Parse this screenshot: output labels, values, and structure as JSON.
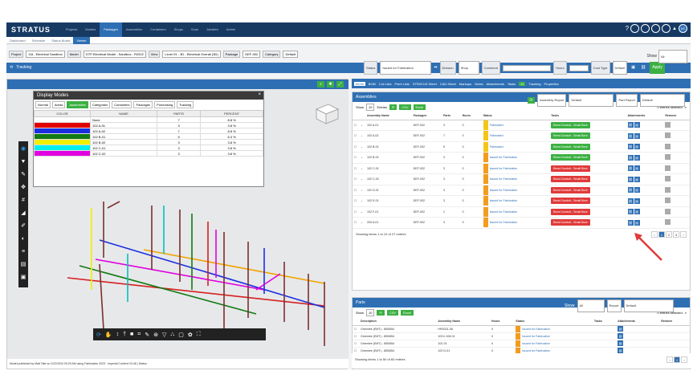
{
  "app": {
    "logo": "STRATUS",
    "nav": [
      "Projects",
      "Models",
      "Packages",
      "Assemblies",
      "Containers",
      "Shops",
      "Scan",
      "Jobsites",
      "Admin"
    ],
    "active_nav": "Packages",
    "subnav": [
      "Dashboard",
      "Schedule",
      "Status Board",
      "Viewer"
    ],
    "active_subnav": "Viewer",
    "avatar": "NT"
  },
  "filters": [
    {
      "label": "Project",
      "value": "GA - Electrical Sandbox"
    },
    {
      "label": "Model",
      "value": "GTP Electrical Model - Sandbox - R2022"
    },
    {
      "label": "View",
      "value": "Level 01 - 3D - Electrical Overall (3D)"
    },
    {
      "label": "Package",
      "value": "DEF-002"
    },
    {
      "label": "Category",
      "value": "Default"
    }
  ],
  "tracking": {
    "title": "Tracking",
    "status_label": "Status",
    "status_value": "Issued for Fabrication",
    "division_label": "Division",
    "division_value": "Shop",
    "comment_label": "Comment",
    "hours_label": "Hours",
    "costtype_label": "Cost Type",
    "costtype_value": "Default",
    "apply": "Apply",
    "show_label": "Show",
    "show_value": "All"
  },
  "display_modes": {
    "title": "Display Modes",
    "tabs": [
      "Normal",
      "Areas",
      "Assemblies",
      "Categories",
      "Containers",
      "Packages",
      "Purchasing",
      "Tracking"
    ],
    "active_tab": "Assemblies",
    "headers": [
      "COLOR",
      "NAME",
      "PARTS",
      "PERCENT"
    ],
    "rows": [
      {
        "color": "#ffffff",
        "name": "None",
        "parts": "7",
        "percent": "8.8 %"
      },
      {
        "color": "#e00000",
        "name": "102 A-01",
        "parts": "3",
        "percent": "3.8 %"
      },
      {
        "color": "#1a2ee0",
        "name": "102 A-02",
        "parts": "7",
        "percent": "8.8 %"
      },
      {
        "color": "#127a12",
        "name": "102 B-01",
        "parts": "5",
        "percent": "6.3 %"
      },
      {
        "color": "#f0f000",
        "name": "102 B-02",
        "parts": "3",
        "percent": "3.8 %"
      },
      {
        "color": "#00f0f0",
        "name": "102 C-01",
        "parts": "3",
        "percent": "3.8 %"
      },
      {
        "color": "#e000e0",
        "name": "102 C-02",
        "parts": "3",
        "percent": "3.8 %"
      }
    ]
  },
  "viewer_footer": "Model published by Matt Tate on 2/22/2024 09:29 AM using Fabrication 2023 · Imperial Content V3.46 | Status",
  "tabs": [
    "Items",
    "BOM",
    "Cut Lists",
    "Point Lists",
    "STRATUS Sheet",
    "CAD Sheet",
    "Markups",
    "Notes",
    "Attachments",
    "Tasks",
    "Tracking",
    "Properties"
  ],
  "active_tab": "Items",
  "tasks_badge": "11",
  "assemblies": {
    "title": "Assemblies",
    "report_label": "Assembly Report",
    "report_value": "Default",
    "part_report_label": "Part Report",
    "part_report_value": "Default",
    "show": "Show",
    "entries": "10",
    "entries_label": "Entries",
    "csv": "CSV",
    "excel": "Excel",
    "selected": "0 entries selected",
    "headers": [
      "Assembly Name",
      "Packages",
      "Parts",
      "Hours",
      "Status",
      "Tasks",
      "Attachments",
      "Remove"
    ],
    "rows": [
      {
        "name": "102 A-01",
        "pkg": "DEF-002",
        "parts": "3",
        "hours": "0",
        "status": "Fabricated",
        "status_color": "#f5c518",
        "task": "Bend Conduit - Small Bore",
        "task_color": "#3cb043"
      },
      {
        "name": "102 A-02",
        "pkg": "DEF-002",
        "parts": "7",
        "hours": "0",
        "status": "Fabricated",
        "status_color": "#f5c518",
        "task": "Bend Conduit - Small Bore",
        "task_color": "#3cb043"
      },
      {
        "name": "102 B-01",
        "pkg": "DEF-002",
        "parts": "5",
        "hours": "0",
        "status": "Fabricated",
        "status_color": "#f5c518",
        "task": "Bend Conduit - Small Bore",
        "task_color": "#3cb043"
      },
      {
        "name": "102 B-02",
        "pkg": "DEF-002",
        "parts": "3",
        "hours": "0",
        "status": "Issued for Fabrication",
        "status_color": "#f39c1f",
        "task": "Bend Conduit - Small Bore",
        "task_color": "#3cb043"
      },
      {
        "name": "102 C-01",
        "pkg": "DEF-002",
        "parts": "3",
        "hours": "0",
        "status": "Issued for Fabrication",
        "status_color": "#f39c1f",
        "task": "Bend Conduit - Small Bore",
        "task_color": "#e03a3a"
      },
      {
        "name": "102 C-02",
        "pkg": "DEF-002",
        "parts": "3",
        "hours": "0",
        "status": "Issued for Fabrication",
        "status_color": "#f39c1f",
        "task": "Bend Conduit - Small Bore",
        "task_color": "#e03a3a"
      },
      {
        "name": "102 D-01",
        "pkg": "DEF-002",
        "parts": "3",
        "hours": "0",
        "status": "Issued for Fabrication",
        "status_color": "#f39c1f",
        "task": "Bend Conduit - Small Bore",
        "task_color": "#e03a3a"
      },
      {
        "name": "102 E-01",
        "pkg": "DEF-002",
        "parts": "3",
        "hours": "0",
        "status": "Issued for Fabrication",
        "status_color": "#f39c1f",
        "task": "Bend Conduit - Small Bore",
        "task_color": "#e03a3a"
      },
      {
        "name": "102 F-01",
        "pkg": "DEF-002",
        "parts": "1",
        "hours": "0",
        "status": "Issued for Fabrication",
        "status_color": "#f39c1f",
        "task": "Bend Conduit - Small Bore",
        "task_color": "#e03a3a"
      },
      {
        "name": "200 A-01",
        "pkg": "DEF-002",
        "parts": "3",
        "hours": "0",
        "status": "Issued for Fabrication",
        "status_color": "#f39c1f",
        "task": "Bend Conduit - Small Bore",
        "task_color": "#e03a3a"
      }
    ],
    "footer": "Showing items 1 to 10 of 27 entries",
    "pages": [
      "‹",
      "1",
      "2",
      "3",
      "›"
    ]
  },
  "parts": {
    "title": "Parts",
    "report_label": "Report",
    "report_value": "Default",
    "show": "Show",
    "entries": "10",
    "csv": "CSV",
    "excel": "Excel",
    "selected": "0 entries selected",
    "headers": [
      "Description",
      "Assembly Name",
      "Hours",
      "Status",
      "Tasks",
      "Attachments",
      "Remove"
    ],
    "rows": [
      {
        "desc": "Greenlee (EMT) - 855/854",
        "asm": "HR0021-08",
        "hours": "0",
        "status": "Issued for Fabrication"
      },
      {
        "desc": "Greenlee (EMT) - 855/854",
        "asm": "103 b 108-01",
        "hours": "0",
        "status": "Issued for Fabrication"
      },
      {
        "desc": "Greenlee (EMT) - 855/854",
        "asm": "102-01",
        "hours": "0",
        "status": "Issued for Fabrication"
      },
      {
        "desc": "Greenlee (EMT) - 855/854",
        "asm": "102 D-01",
        "hours": "0",
        "status": "Issued for Fabrication"
      },
      {
        "desc": "Greenlee (EMT) - 855/854",
        "asm": "102 E-01",
        "hours": "0",
        "status": "Issued for Fabrication"
      }
    ],
    "footer": "Showing items 1 to 50 of 60 entries",
    "pages": [
      "‹",
      "1",
      "›"
    ]
  }
}
